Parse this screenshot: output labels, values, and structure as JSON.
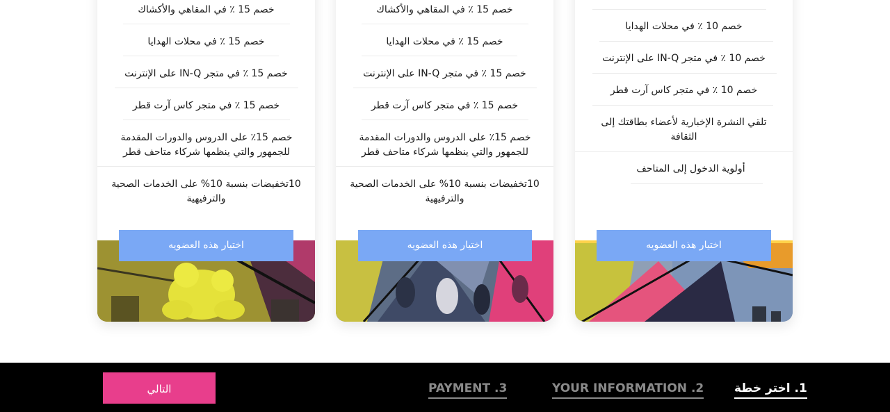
{
  "plans": [
    {
      "features": [
        "خصم 10 ٪ في محلات الهدايا",
        "خصم 10 ٪ في متجر IN-Q على الإنترنت",
        "خصم 10 ٪ في متجر كاس آرت قطر",
        "تلقي النشرة الإخبارية لأعضاء بطاقتك إلى الثقافة",
        "أولوية الدخول إلى المتاحف"
      ],
      "button_label": "اختيار هذه العضويه"
    },
    {
      "features": [
        "خصم 15 ٪ في المقاهي والأكشاك",
        "خصم 15 ٪ في محلات الهدايا",
        "خصم 15 ٪ في متجر IN-Q على الإنترنت",
        "خصم 15 ٪ في متجر كاس آرت قطر",
        "خصم 15٪ على الدروس والدورات المقدمة للجمهور والتي ينظمها شركاء متاحف قطر",
        "10تخفيضات بنسبة 10% على الخدمات الصحية والترفيهية"
      ],
      "button_label": "اختيار هذه العضويه"
    },
    {
      "features": [
        "خصم 15 ٪ في المقاهي والأكشاك",
        "خصم 15 ٪ في محلات الهدايا",
        "خصم 15 ٪ في متجر IN-Q على الإنترنت",
        "خصم 15 ٪ في متجر كاس آرت قطر",
        "خصم 15٪ على الدروس والدورات المقدمة للجمهور والتي ينظمها شركاء متاحف قطر",
        "10تخفيضات بنسبة 10% على الخدمات الصحية والترفيهية"
      ],
      "button_label": "اختيار هذه العضويه"
    }
  ],
  "footer": {
    "steps": [
      "1. اختر خطة",
      "YOUR INFORMATION .2",
      "PAYMENT .3"
    ],
    "active_step": 0,
    "next_label": "التالي"
  },
  "colors": {
    "choose_button": "#7aa8f5",
    "next_button": "#e83e8c",
    "footer_bg": "#000000"
  }
}
